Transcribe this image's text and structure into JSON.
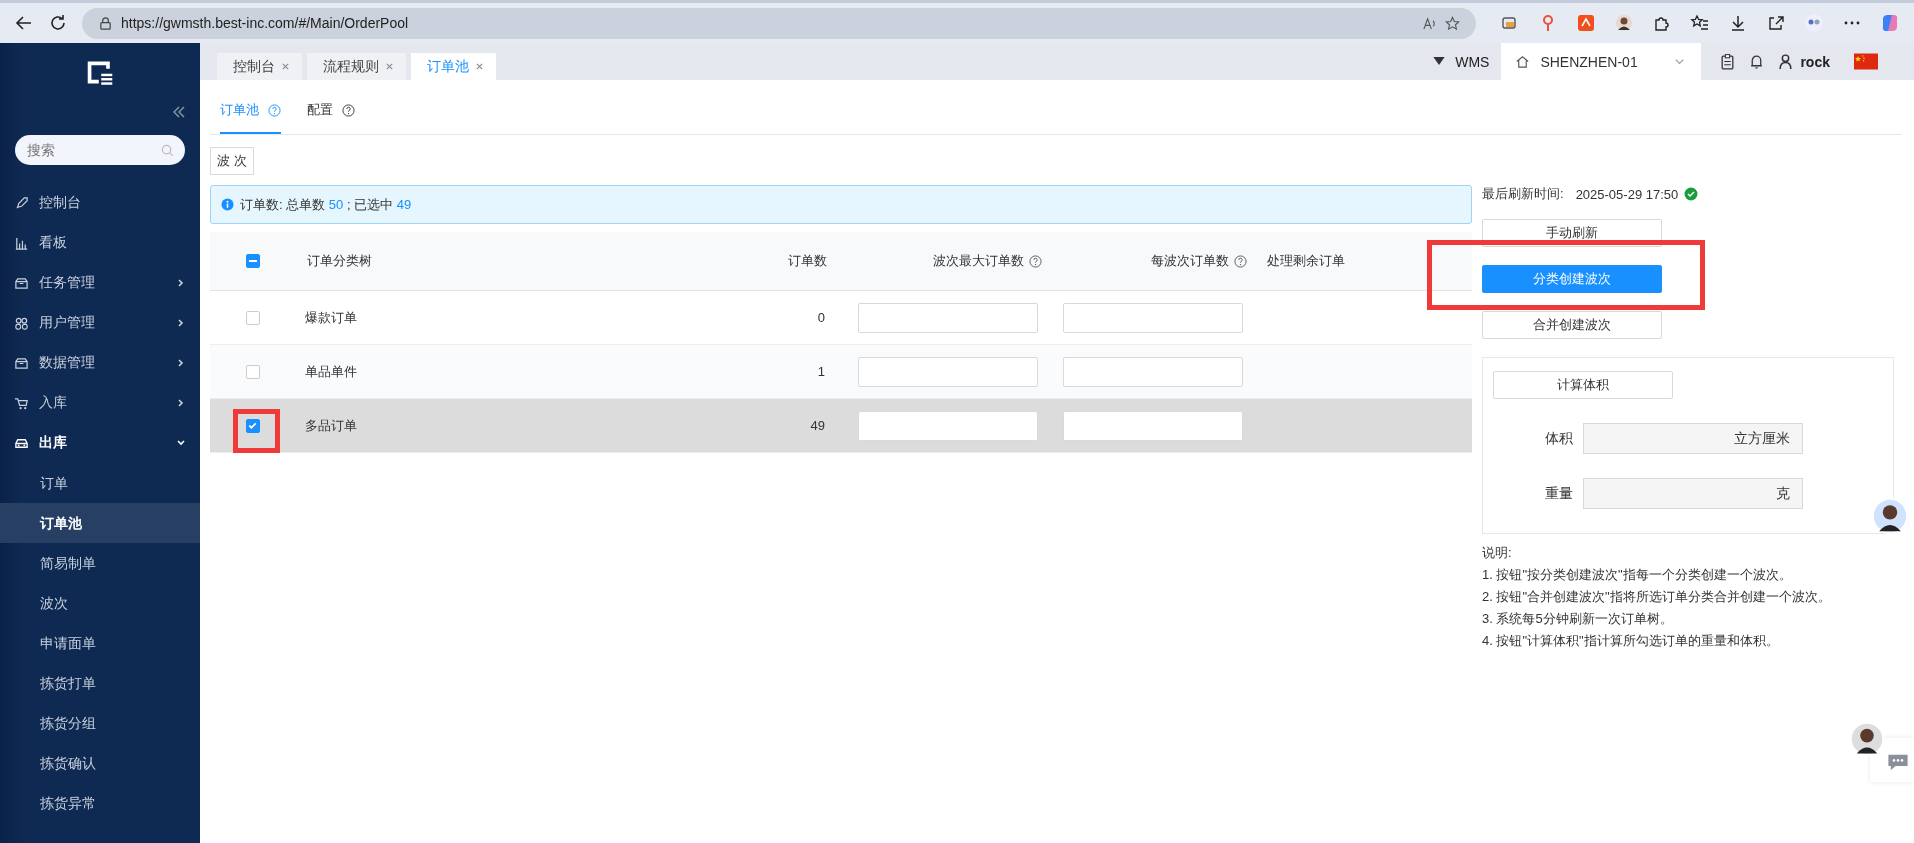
{
  "browser": {
    "url": "https://gwmsth.best-inc.com/#/Main/OrderPool"
  },
  "tabs": [
    {
      "label": "控制台",
      "selected": false
    },
    {
      "label": "流程规则",
      "selected": false
    },
    {
      "label": "订单池",
      "selected": true
    }
  ],
  "header": {
    "system": "WMS",
    "warehouse": "SHENZHEN-01",
    "user": "rock"
  },
  "sidebar": {
    "search_placeholder": "搜索",
    "items": [
      {
        "label": "控制台"
      },
      {
        "label": "看板"
      },
      {
        "label": "任务管理",
        "expanded": false
      },
      {
        "label": "用户管理",
        "expanded": false
      },
      {
        "label": "数据管理",
        "expanded": false
      },
      {
        "label": "入库",
        "expanded": false
      },
      {
        "label": "出库",
        "expanded": true,
        "children": [
          {
            "label": "订单",
            "selected": false
          },
          {
            "label": "订单池",
            "selected": true
          },
          {
            "label": "简易制单",
            "selected": false
          },
          {
            "label": "波次",
            "selected": false
          },
          {
            "label": "申请面单",
            "selected": false
          },
          {
            "label": "拣货打单",
            "selected": false
          },
          {
            "label": "拣货分组",
            "selected": false
          },
          {
            "label": "拣货确认",
            "selected": false
          },
          {
            "label": "拣货异常",
            "selected": false
          }
        ]
      }
    ]
  },
  "subtabs": [
    {
      "label": "订单池",
      "selected": true
    },
    {
      "label": "配置",
      "selected": false
    }
  ],
  "wave_button": "波 次",
  "alert": {
    "label": "订单数: 总单数",
    "total": "50",
    "separator": ";",
    "selected_label": "已选中",
    "selected_count": "49"
  },
  "table": {
    "select_all": {
      "indeterminate": true
    },
    "columns": [
      {
        "label": "订单分类树",
        "help": false
      },
      {
        "label": "订单数",
        "help": false
      },
      {
        "label": "波次最大订单数",
        "help": true
      },
      {
        "label": "每波次订单数",
        "help": true
      },
      {
        "label": "处理剩余订单",
        "help": false
      }
    ],
    "rows": [
      {
        "name": "爆款订单",
        "count": "0",
        "checked": false,
        "highlighted": false
      },
      {
        "name": "单品单件",
        "count": "1",
        "checked": false,
        "highlighted": false
      },
      {
        "name": "多品订单",
        "count": "49",
        "checked": true,
        "highlighted": true
      }
    ]
  },
  "refresh": {
    "label": "最后刷新时间:",
    "time": "2025-05-29 17:50",
    "ok": true
  },
  "actions": [
    {
      "label": "手动刷新",
      "kind": "default"
    },
    {
      "label": "分类创建波次",
      "kind": "primary",
      "highlighted": true
    },
    {
      "label": "合并创建波次",
      "kind": "default"
    }
  ],
  "calc": {
    "button": "计算体积",
    "fields": [
      {
        "label": "体积",
        "unit": "立方厘米"
      },
      {
        "label": "重量",
        "unit": "克"
      }
    ]
  },
  "notes": {
    "title": "说明:",
    "lines": [
      "1. 按钮\"按分类创建波次\"指每一个分类创建一个波次。",
      "2. 按钮\"合并创建波次\"指将所选订单分类合并创建一个波次。",
      "3. 系统每5分钟刷新一次订单树。",
      "4. 按钮\"计算体积\"指计算所勾选订单的重量和体积。"
    ]
  }
}
